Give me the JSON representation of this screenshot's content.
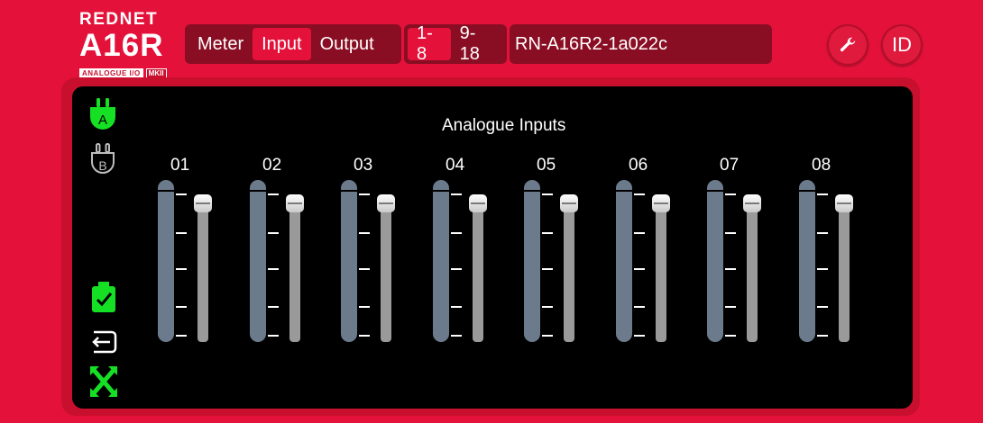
{
  "logo": {
    "brand": "REDNET",
    "model": "A16R",
    "sub": "ANALOGUE I/O",
    "badge": "MKII"
  },
  "modes": [
    {
      "label": "Meter",
      "active": false
    },
    {
      "label": "Input",
      "active": true
    },
    {
      "label": "Output",
      "active": false
    }
  ],
  "ranges": [
    {
      "label": "1-8",
      "active": true
    },
    {
      "label": "9-18",
      "active": false
    }
  ],
  "device_name": "RN-A16R2-1a022c",
  "actions": {
    "id_label": "ID"
  },
  "side": {
    "network_a": "A",
    "network_b": "B"
  },
  "main": {
    "title": "Analogue Inputs",
    "channels": [
      "01",
      "02",
      "03",
      "04",
      "05",
      "06",
      "07",
      "08"
    ]
  },
  "colors": {
    "accent": "#e4123a",
    "dark": "#8a0e23",
    "status_green": "#16e024",
    "meter": "#6b7b8c"
  }
}
